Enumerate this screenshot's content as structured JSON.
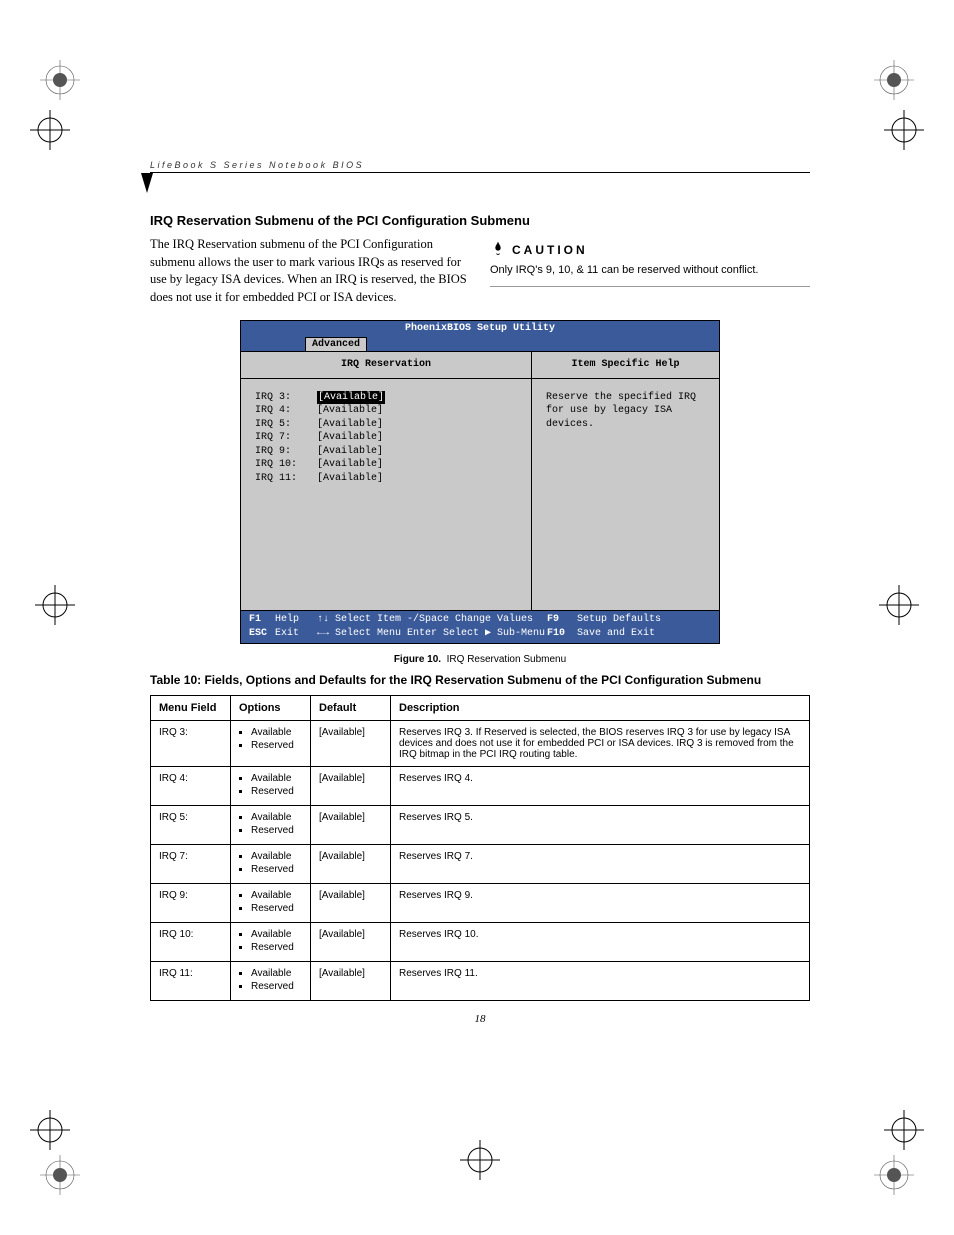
{
  "header": {
    "running": "LifeBook S Series Notebook BIOS"
  },
  "section_title": "IRQ Reservation Submenu of the PCI Configuration Submenu",
  "intro": "The IRQ Reservation submenu of the PCI Configuration submenu allows the user to mark various IRQs as reserved for use by legacy ISA devices. When an IRQ is reserved, the BIOS does not use it for embedded PCI or ISA devices.",
  "caution": {
    "label": "CAUTION",
    "text": "Only IRQ's 9, 10, & 11 can be reserved without conflict."
  },
  "bios": {
    "title": "PhoenixBIOS Setup Utility",
    "tab": "Advanced",
    "left_title": "IRQ Reservation",
    "right_title": "Item Specific Help",
    "help_text": "Reserve the specified IRQ for use by legacy ISA devices.",
    "rows": [
      {
        "k": "IRQ 3:",
        "v": "[Available]",
        "sel": true
      },
      {
        "k": "IRQ 4:",
        "v": "[Available]",
        "sel": false
      },
      {
        "k": "IRQ 5:",
        "v": "[Available]",
        "sel": false
      },
      {
        "k": "IRQ 7:",
        "v": "[Available]",
        "sel": false
      },
      {
        "k": "IRQ 9:",
        "v": "[Available]",
        "sel": false
      },
      {
        "k": "IRQ 10:",
        "v": "[Available]",
        "sel": false
      },
      {
        "k": "IRQ 11:",
        "v": "[Available]",
        "sel": false
      }
    ],
    "footer": {
      "f1": "F1",
      "help": "Help",
      "esc": "ESC",
      "exit": "Exit",
      "sel_item": "↑↓ Select Item",
      "sel_menu": "←→ Select Menu",
      "change": "-/Space Change Values",
      "enter": "Enter Select ▶ Sub-Menu",
      "f9": "F9",
      "defaults": "Setup Defaults",
      "f10": "F10",
      "save": "Save and Exit"
    }
  },
  "figure": {
    "num": "Figure 10.",
    "title": "IRQ Reservation Submenu"
  },
  "table_title": "Table 10: Fields, Options and Defaults for the IRQ Reservation Submenu of the PCI Configuration Submenu",
  "table": {
    "headers": {
      "menu": "Menu Field",
      "opts": "Options",
      "def": "Default",
      "desc": "Description"
    },
    "opts": [
      "Available",
      "Reserved"
    ],
    "rows": [
      {
        "menu": "IRQ 3:",
        "def": "[Available]",
        "desc": "Reserves IRQ 3. If Reserved is selected, the BIOS reserves IRQ 3 for use by legacy ISA devices and does not use it for embedded PCI or ISA devices. IRQ 3 is removed from the IRQ bitmap in the PCI IRQ routing table."
      },
      {
        "menu": "IRQ 4:",
        "def": "[Available]",
        "desc": "Reserves IRQ 4."
      },
      {
        "menu": "IRQ 5:",
        "def": "[Available]",
        "desc": "Reserves IRQ 5."
      },
      {
        "menu": "IRQ 7:",
        "def": "[Available]",
        "desc": "Reserves IRQ 7."
      },
      {
        "menu": "IRQ 9:",
        "def": "[Available]",
        "desc": "Reserves IRQ 9."
      },
      {
        "menu": "IRQ 10:",
        "def": "[Available]",
        "desc": "Reserves IRQ 10."
      },
      {
        "menu": "IRQ 11:",
        "def": "[Available]",
        "desc": "Reserves IRQ 11."
      }
    ]
  },
  "page_number": "18"
}
